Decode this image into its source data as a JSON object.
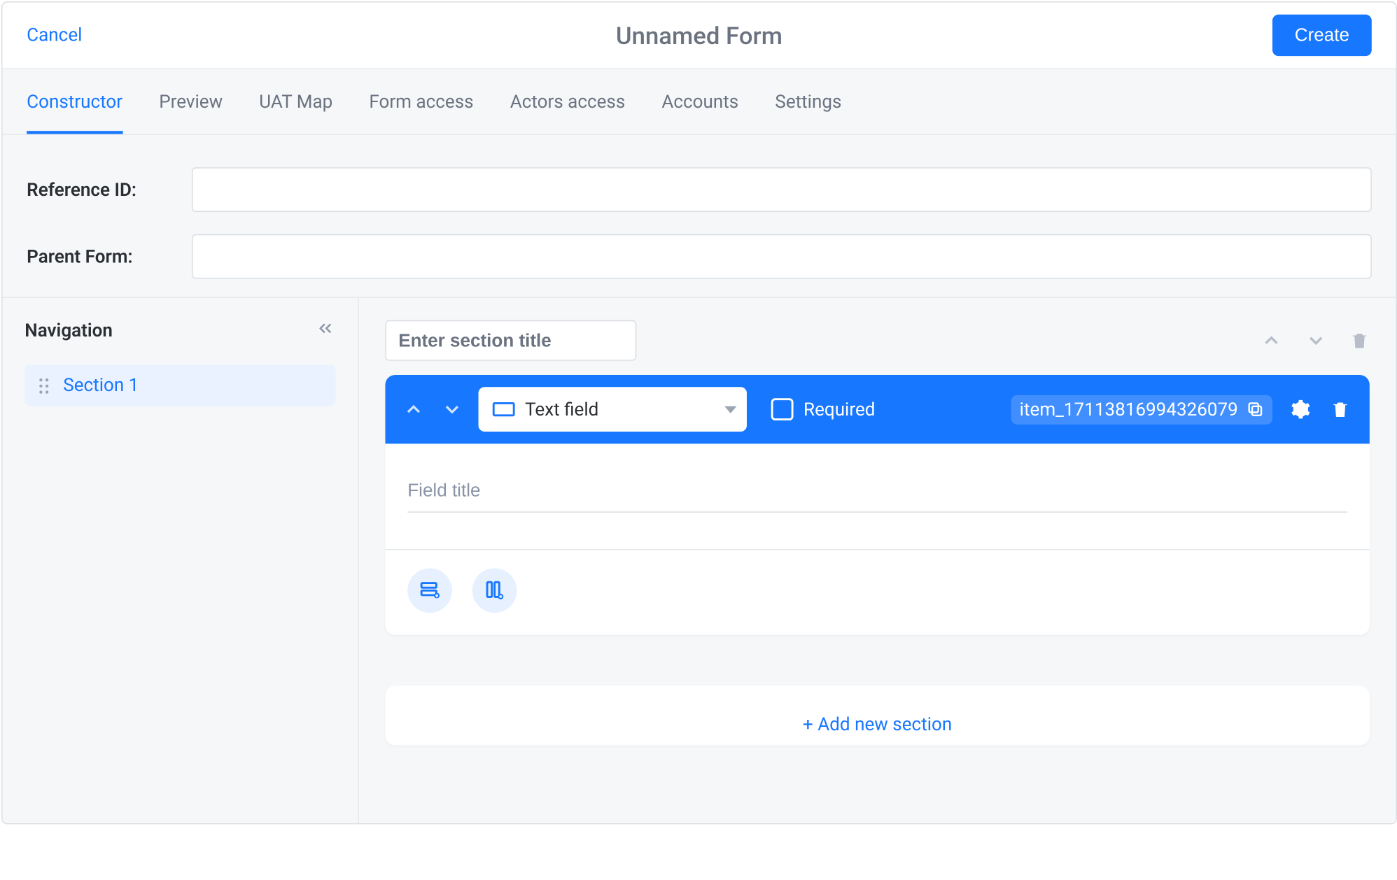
{
  "header": {
    "cancel": "Cancel",
    "title": "Unnamed Form",
    "create": "Create"
  },
  "tabs": [
    {
      "id": "constructor",
      "label": "Constructor",
      "active": true
    },
    {
      "id": "preview",
      "label": "Preview",
      "active": false
    },
    {
      "id": "uat-map",
      "label": "UAT Map",
      "active": false
    },
    {
      "id": "form-access",
      "label": "Form access",
      "active": false
    },
    {
      "id": "actors-access",
      "label": "Actors access",
      "active": false
    },
    {
      "id": "accounts",
      "label": "Accounts",
      "active": false
    },
    {
      "id": "settings",
      "label": "Settings",
      "active": false
    }
  ],
  "form": {
    "reference_id_label": "Reference ID:",
    "reference_id_value": "",
    "parent_form_label": "Parent Form:",
    "parent_form_value": ""
  },
  "sidebar": {
    "title": "Navigation",
    "items": [
      {
        "label": "Section 1"
      }
    ]
  },
  "section": {
    "title_placeholder": "Enter section title",
    "title_value": ""
  },
  "field": {
    "type_label": "Text field",
    "required_label": "Required",
    "required_checked": false,
    "item_id": "item_17113816994326079",
    "field_title_placeholder": "Field title",
    "field_title_value": ""
  },
  "add_section_label": "+ Add new section"
}
